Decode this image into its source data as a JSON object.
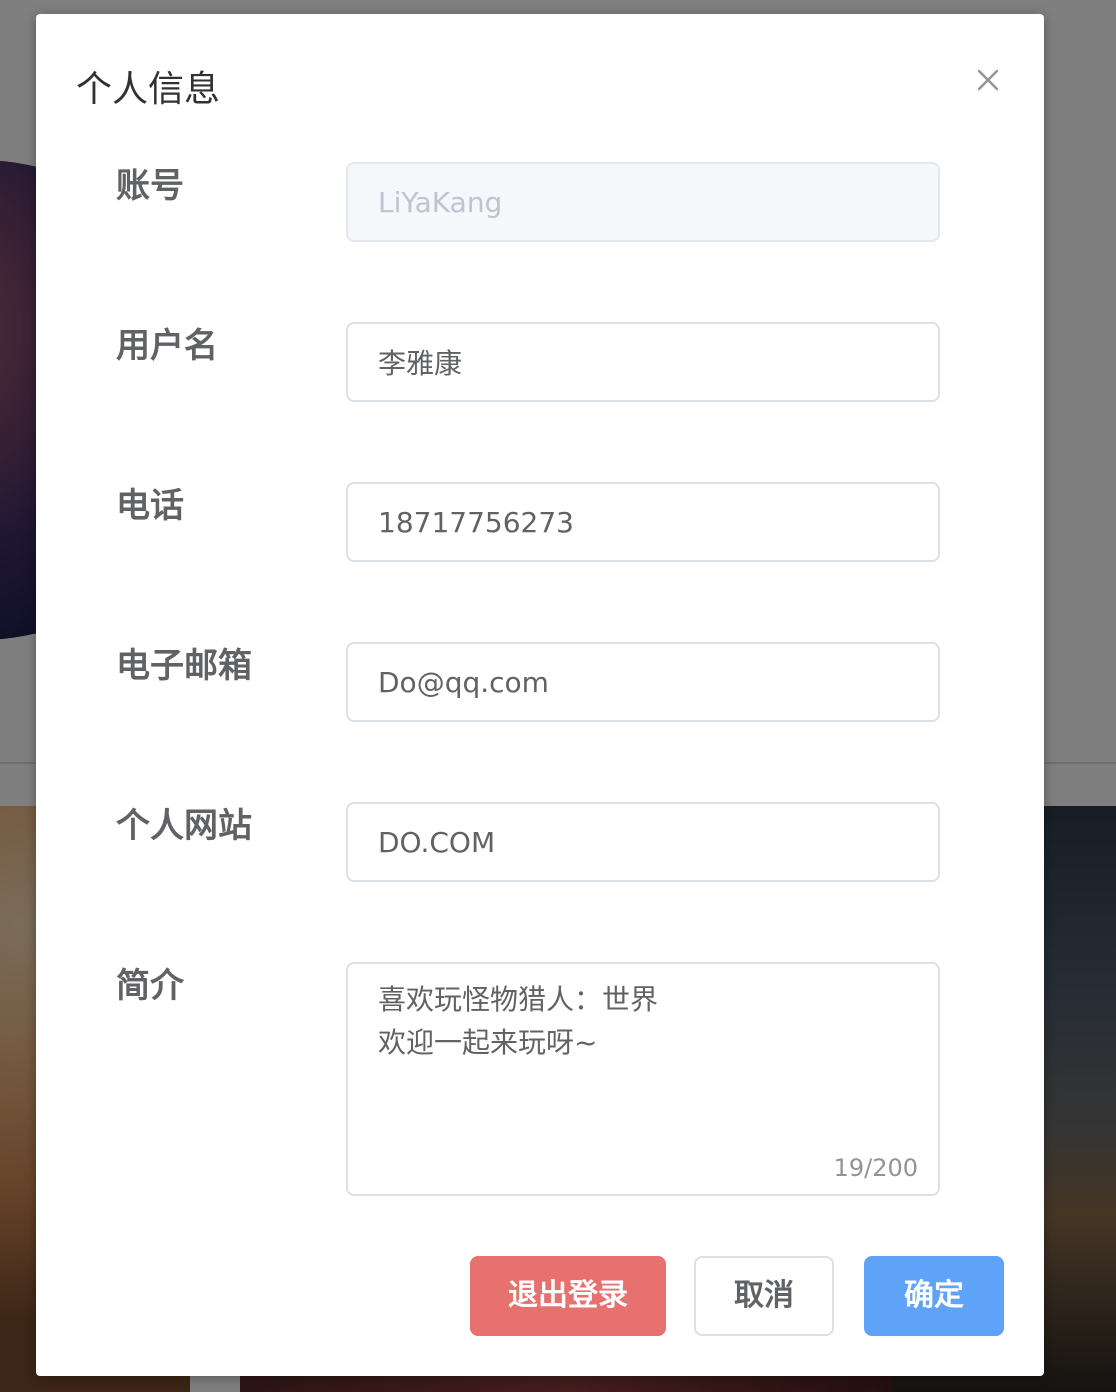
{
  "dialog": {
    "title": "个人信息",
    "close_icon": "close-icon"
  },
  "form": {
    "account": {
      "label": "账号",
      "value": "LiYaKang",
      "disabled": true
    },
    "username": {
      "label": "用户名",
      "value": "李雅康"
    },
    "phone": {
      "label": "电话",
      "value": "18717756273"
    },
    "email": {
      "label": "电子邮箱",
      "value": "Do@qq.com"
    },
    "website": {
      "label": "个人网站",
      "value": "DO.COM"
    },
    "bio": {
      "label": "简介",
      "value": "喜欢玩怪物猎人：世界\n欢迎一起来玩呀~",
      "count": "19/200"
    }
  },
  "buttons": {
    "logout": "退出登录",
    "cancel": "取消",
    "confirm": "确定"
  },
  "colors": {
    "logout": "#e6716f",
    "confirm": "#5ea3f7",
    "label": "#606266",
    "border": "#dcdfe6"
  }
}
